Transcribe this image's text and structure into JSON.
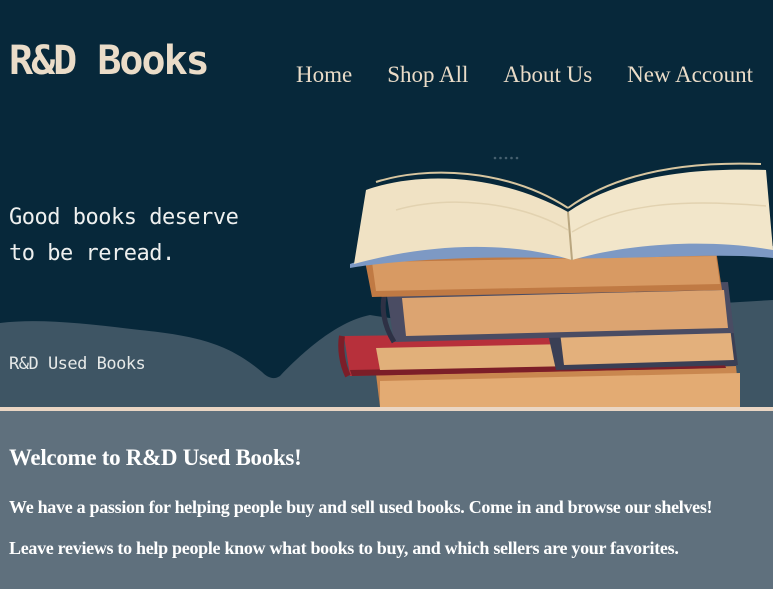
{
  "header": {
    "brand": "R&D Books",
    "nav": [
      "Home",
      "Shop All",
      "About Us",
      "New Account"
    ]
  },
  "hero": {
    "tagline_line1": "Good books deserve",
    "tagline_line2": "to be reread.",
    "store_name": "R&D Used Books",
    "image_alt": "stack-of-books-illustration"
  },
  "welcome": {
    "heading": "Welcome to R&D Used Books!",
    "paragraph1": "We have a passion for helping people buy and sell used books. Come in and browse our shelves!",
    "paragraph2": "Leave reviews to help people know what books to buy, and which sellers are your favorites."
  },
  "colors": {
    "hero_bg": "#07283a",
    "hill": "#3e5564",
    "accent_cream": "#eadcc8",
    "content_bg": "#5f707d"
  }
}
